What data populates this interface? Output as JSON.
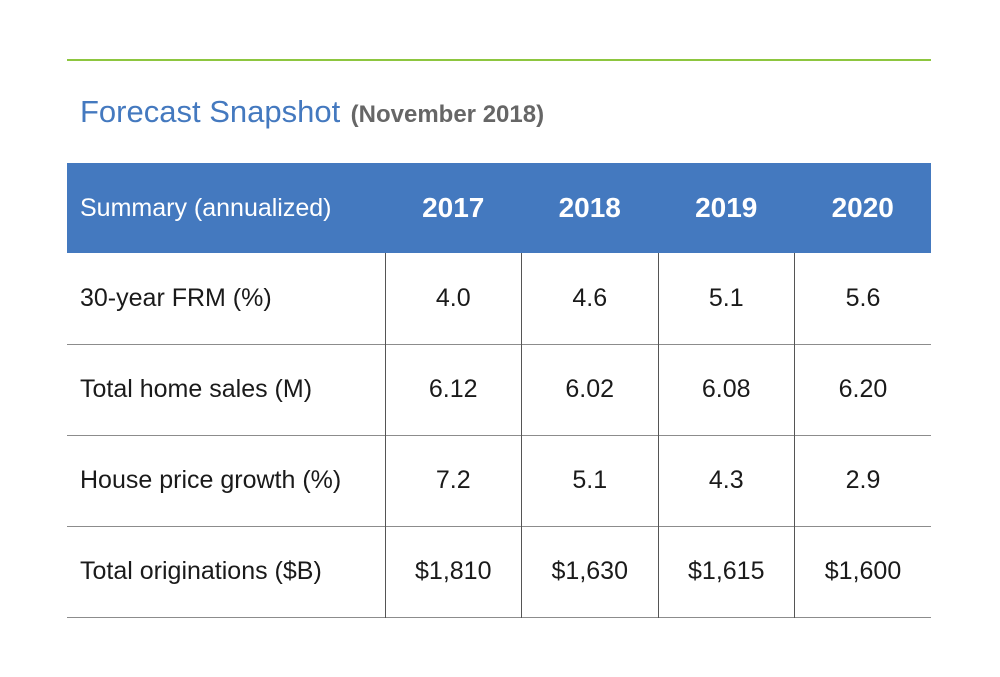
{
  "title": {
    "main": "Forecast Snapshot",
    "sub": "(November 2018)"
  },
  "colors": {
    "accent_blue": "#4479bf",
    "rule_green": "#8dc63f",
    "subtitle_gray": "#666666"
  },
  "table": {
    "header_label": "Summary (annualized)",
    "years": [
      "2017",
      "2018",
      "2019",
      "2020"
    ],
    "rows": [
      {
        "label": "30-year FRM (%)",
        "values": [
          "4.0",
          "4.6",
          "5.1",
          "5.6"
        ]
      },
      {
        "label": "Total home sales (M)",
        "values": [
          "6.12",
          "6.02",
          "6.08",
          "6.20"
        ]
      },
      {
        "label": "House price growth (%)",
        "values": [
          "7.2",
          "5.1",
          "4.3",
          "2.9"
        ]
      },
      {
        "label": "Total originations ($B)",
        "values": [
          "$1,810",
          "$1,630",
          "$1,615",
          "$1,600"
        ]
      }
    ]
  }
}
